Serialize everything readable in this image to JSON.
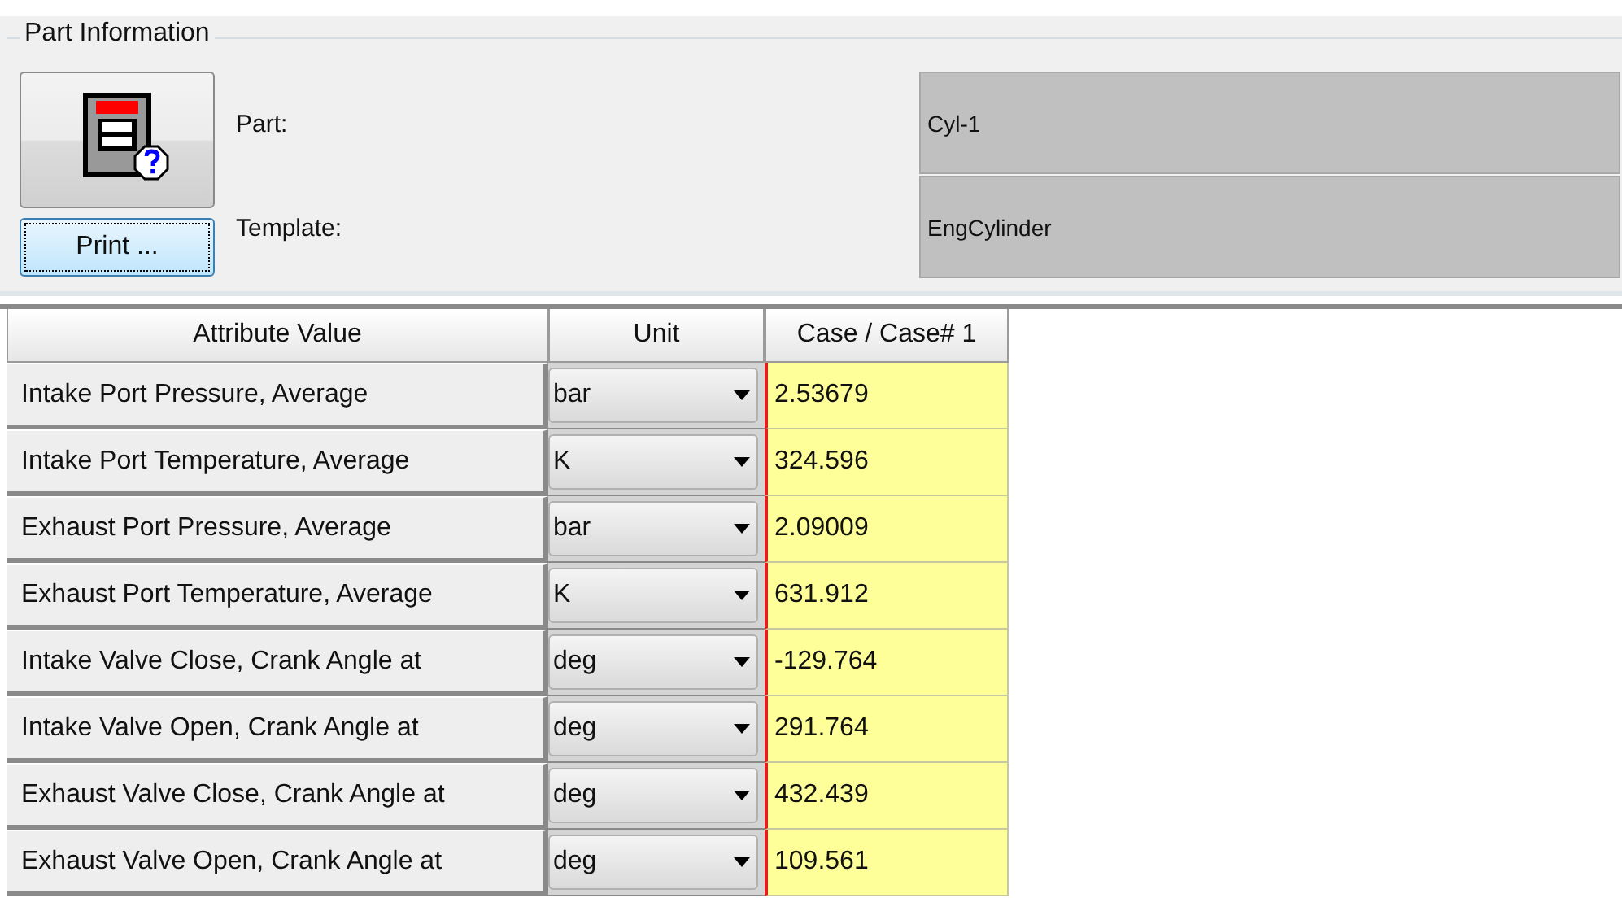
{
  "group": {
    "title": "Part Information"
  },
  "print_button": {
    "label": "Print ..."
  },
  "fields": [
    {
      "label": "Part:",
      "value": "Cyl-1"
    },
    {
      "label": "Template:",
      "value": "EngCylinder"
    }
  ],
  "table": {
    "columns": [
      "Attribute Value",
      "Unit",
      "Case / Case# 1"
    ],
    "rows": [
      {
        "attribute": "Intake Port Pressure, Average",
        "unit": "bar",
        "value": "2.53679"
      },
      {
        "attribute": "Intake Port Temperature, Average",
        "unit": "K",
        "value": "324.596"
      },
      {
        "attribute": "Exhaust Port Pressure, Average",
        "unit": "bar",
        "value": "2.09009"
      },
      {
        "attribute": "Exhaust Port Temperature, Average",
        "unit": "K",
        "value": "631.912"
      },
      {
        "attribute": "Intake Valve Close, Crank Angle at",
        "unit": "deg",
        "value": "-129.764"
      },
      {
        "attribute": "Intake Valve Open, Crank Angle at",
        "unit": "deg",
        "value": "291.764"
      },
      {
        "attribute": "Exhaust Valve Close, Crank Angle at",
        "unit": "deg",
        "value": "432.439"
      },
      {
        "attribute": "Exhaust Valve Open, Crank Angle at",
        "unit": "deg",
        "value": "109.561"
      }
    ]
  }
}
